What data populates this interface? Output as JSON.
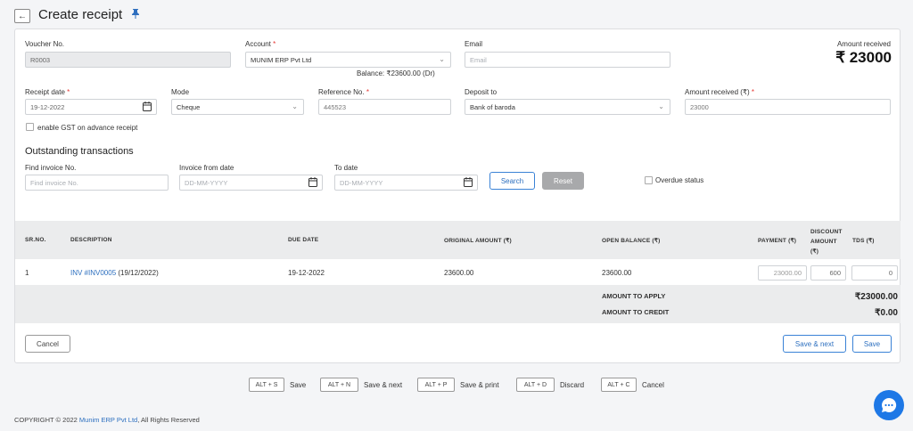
{
  "header": {
    "title": "Create receipt",
    "back_icon": "arrow-left-icon",
    "pin_icon": "pin-icon"
  },
  "form": {
    "voucher_no": {
      "label": "Voucher No.",
      "value": "R0003"
    },
    "account": {
      "label": "Account",
      "value": "MUNIM ERP Pvt Ltd",
      "balance": "Balance: ₹23600.00 (Dr)"
    },
    "email": {
      "label": "Email",
      "placeholder": "Email"
    },
    "amount_received_display": {
      "label": "Amount received",
      "value": "₹ 23000"
    },
    "receipt_date": {
      "label": "Receipt date",
      "value": "19-12-2022"
    },
    "mode": {
      "label": "Mode",
      "value": "Cheque"
    },
    "reference_no": {
      "label": "Reference No.",
      "value": "445523"
    },
    "deposit_to": {
      "label": "Deposit to",
      "value": "Bank of baroda"
    },
    "amount_received": {
      "label": "Amount received (₹)",
      "value": "23000"
    },
    "gst_checkbox": {
      "label": "enable GST on advance receipt"
    },
    "required_mark": "*"
  },
  "outstanding": {
    "title": "Outstanding transactions",
    "find_invoice": {
      "label": "Find invoice No.",
      "placeholder": "Find invoice No."
    },
    "from_date": {
      "label": "Invoice from date",
      "placeholder": "DD-MM-YYYY"
    },
    "to_date": {
      "label": "To date",
      "placeholder": "DD-MM-YYYY"
    },
    "search_label": "Search",
    "reset_label": "Reset",
    "overdue_label": "Overdue status"
  },
  "table": {
    "headers": {
      "sr": "SR.NO.",
      "description": "DESCRIPTION",
      "due_date": "DUE DATE",
      "original_amount": "ORIGINAL AMOUNT (₹)",
      "open_balance": "OPEN BALANCE (₹)",
      "payment": "PAYMENT (₹)",
      "discount_l1": "DISCOUNT",
      "discount_l2": "AMOUNT",
      "discount_l3": "(₹)",
      "tds": "TDS (₹)"
    },
    "rows": [
      {
        "sr": "1",
        "invoice_link": "INV #INV0005",
        "invoice_date": "(19/12/2022)",
        "due_date": "19-12-2022",
        "original_amount": "23600.00",
        "open_balance": "23600.00",
        "payment": "23000.00",
        "discount": "600",
        "tds": "0"
      }
    ],
    "totals": {
      "apply_label": "AMOUNT TO APPLY",
      "apply_value": "₹23000.00",
      "credit_label": "AMOUNT TO CREDIT",
      "credit_value": "₹0.00"
    }
  },
  "actions": {
    "cancel": "Cancel",
    "save_next": "Save & next",
    "save": "Save"
  },
  "shortcuts": [
    {
      "key": "ALT + S",
      "label": "Save"
    },
    {
      "key": "ALT + N",
      "label": "Save & next"
    },
    {
      "key": "ALT + P",
      "label": "Save & print"
    },
    {
      "key": "ALT + D",
      "label": "Discard"
    },
    {
      "key": "ALT + C",
      "label": "Cancel"
    }
  ],
  "footer": {
    "prefix": "COPYRIGHT © 2022 ",
    "company": "Munim ERP Pvt Ltd",
    "suffix": ", All Rights Reserved"
  },
  "colors": {
    "accent": "#2c6fbf",
    "required": "#e53935",
    "chat": "#1e78e6"
  }
}
